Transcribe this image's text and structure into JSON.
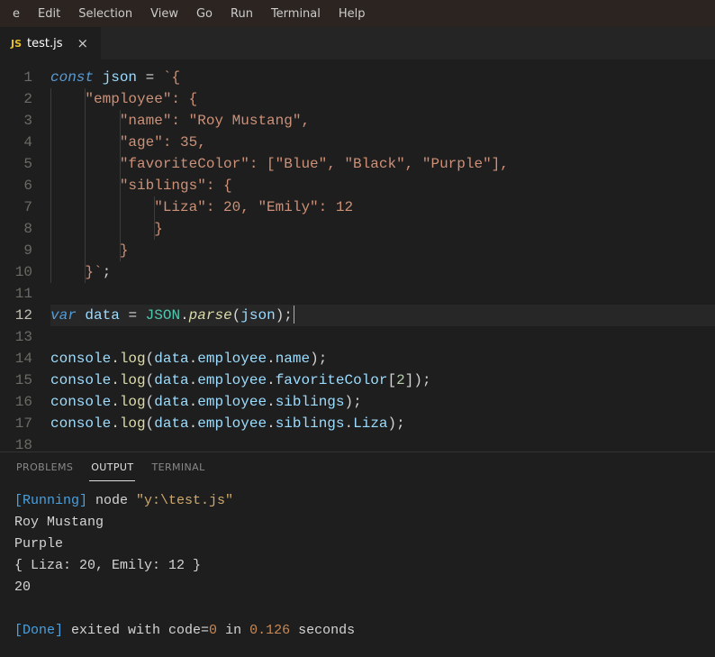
{
  "menu": [
    "e",
    "Edit",
    "Selection",
    "View",
    "Go",
    "Run",
    "Terminal",
    "Help"
  ],
  "tab": {
    "icon": "JS",
    "label": "test.js"
  },
  "activeLine": 12,
  "code": [
    [
      [
        "k",
        "const"
      ],
      [
        "p",
        " "
      ],
      [
        "v",
        "json"
      ],
      [
        "p",
        " "
      ],
      [
        "p",
        "="
      ],
      [
        "p",
        " "
      ],
      [
        "s",
        "`{"
      ]
    ],
    [
      [
        "s",
        "    \"employee\": {"
      ]
    ],
    [
      [
        "s",
        "        \"name\": \"Roy Mustang\","
      ]
    ],
    [
      [
        "s",
        "        \"age\": 35,"
      ]
    ],
    [
      [
        "s",
        "        \"favoriteColor\": [\"Blue\", \"Black\", \"Purple\"],"
      ]
    ],
    [
      [
        "s",
        "        \"siblings\": {"
      ]
    ],
    [
      [
        "s",
        "            \"Liza\": 20, \"Emily\": 12"
      ]
    ],
    [
      [
        "s",
        "            }"
      ]
    ],
    [
      [
        "s",
        "        }"
      ]
    ],
    [
      [
        "s",
        "    }`"
      ],
      [
        "p",
        ";"
      ]
    ],
    [],
    [
      [
        "k",
        "var"
      ],
      [
        "p",
        " "
      ],
      [
        "v",
        "data"
      ],
      [
        "p",
        " "
      ],
      [
        "p",
        "="
      ],
      [
        "p",
        " "
      ],
      [
        "cls",
        "JSON"
      ],
      [
        "p",
        "."
      ],
      [
        "fi",
        "parse"
      ],
      [
        "p",
        "("
      ],
      [
        "vr",
        "json"
      ],
      [
        "p",
        ");"
      ]
    ],
    [],
    [
      [
        "vr",
        "console"
      ],
      [
        "p",
        "."
      ],
      [
        "fn",
        "log"
      ],
      [
        "p",
        "("
      ],
      [
        "vr",
        "data"
      ],
      [
        "p",
        "."
      ],
      [
        "vr",
        "employee"
      ],
      [
        "p",
        "."
      ],
      [
        "vr",
        "name"
      ],
      [
        "p",
        ");"
      ]
    ],
    [
      [
        "vr",
        "console"
      ],
      [
        "p",
        "."
      ],
      [
        "fn",
        "log"
      ],
      [
        "p",
        "("
      ],
      [
        "vr",
        "data"
      ],
      [
        "p",
        "."
      ],
      [
        "vr",
        "employee"
      ],
      [
        "p",
        "."
      ],
      [
        "vr",
        "favoriteColor"
      ],
      [
        "p",
        "["
      ],
      [
        "n",
        "2"
      ],
      [
        "p",
        "]);"
      ]
    ],
    [
      [
        "vr",
        "console"
      ],
      [
        "p",
        "."
      ],
      [
        "fn",
        "log"
      ],
      [
        "p",
        "("
      ],
      [
        "vr",
        "data"
      ],
      [
        "p",
        "."
      ],
      [
        "vr",
        "employee"
      ],
      [
        "p",
        "."
      ],
      [
        "vr",
        "siblings"
      ],
      [
        "p",
        ");"
      ]
    ],
    [
      [
        "vr",
        "console"
      ],
      [
        "p",
        "."
      ],
      [
        "fn",
        "log"
      ],
      [
        "p",
        "("
      ],
      [
        "vr",
        "data"
      ],
      [
        "p",
        "."
      ],
      [
        "vr",
        "employee"
      ],
      [
        "p",
        "."
      ],
      [
        "vr",
        "siblings"
      ],
      [
        "p",
        "."
      ],
      [
        "vr",
        "Liza"
      ],
      [
        "p",
        ");"
      ]
    ],
    []
  ],
  "panelTabs": [
    {
      "label": "PROBLEMS",
      "active": false
    },
    {
      "label": "OUTPUT",
      "active": true
    },
    {
      "label": "TERMINAL",
      "active": false
    }
  ],
  "output": [
    [
      [
        "o-blue",
        "[Running]"
      ],
      [
        "o-txt",
        " node "
      ],
      [
        "o-gold",
        "\"y:\\test.js\""
      ]
    ],
    [
      [
        "o-txt",
        "Roy Mustang"
      ]
    ],
    [
      [
        "o-txt",
        "Purple"
      ]
    ],
    [
      [
        "o-txt",
        "{ Liza: 20, Emily: 12 }"
      ]
    ],
    [
      [
        "o-txt",
        "20"
      ]
    ],
    [],
    [
      [
        "o-blue",
        "[Done]"
      ],
      [
        "o-txt",
        " exited with code="
      ],
      [
        "o-orng",
        "0"
      ],
      [
        "o-txt",
        " in "
      ],
      [
        "o-orng",
        "0.126"
      ],
      [
        "o-txt",
        " seconds"
      ]
    ]
  ]
}
